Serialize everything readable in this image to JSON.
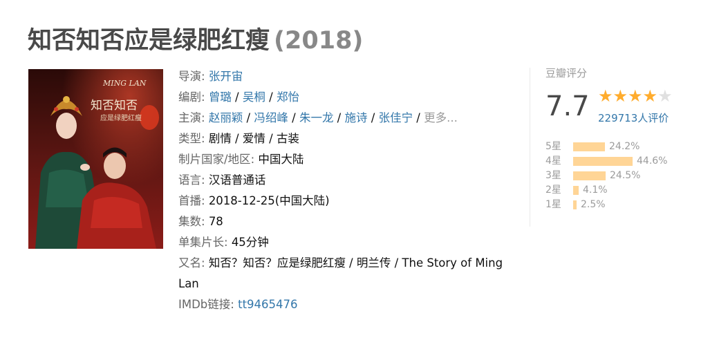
{
  "title": "知否知否应是绿肥红瘦",
  "year": "(2018)",
  "poster": {
    "alt": "知否知否应是绿肥红瘦 海报",
    "logo_en": "MING LAN",
    "logo_cn": "知否知否",
    "logo_sub": "应是绿肥红瘦"
  },
  "info": {
    "director_label": "导演",
    "directors": [
      "张开宙"
    ],
    "writer_label": "编剧",
    "writers": [
      "曾璐",
      "吴桐",
      "郑怡"
    ],
    "cast_label": "主演",
    "cast": [
      "赵丽颖",
      "冯绍峰",
      "朱一龙",
      "施诗",
      "张佳宁"
    ],
    "more_label": "更多...",
    "genre_label": "类型",
    "genre_value": "剧情 / 爱情 / 古装",
    "country_label": "制片国家/地区",
    "country_value": "中国大陆",
    "language_label": "语言",
    "language_value": "汉语普通话",
    "premiere_label": "首播",
    "premiere_value": "2018-12-25(中国大陆)",
    "episodes_label": "集数",
    "episodes_value": "78",
    "runtime_label": "单集片长",
    "runtime_value": "45分钟",
    "aka_label": "又名",
    "aka_value": "知否？知否？应是绿肥红瘦 / 明兰传 / The Story of Ming Lan",
    "imdb_label": "IMDb链接",
    "imdb_value": "tt9465476",
    "colon": ": "
  },
  "rating": {
    "label": "豆瓣评分",
    "score": "7.7",
    "stars_filled": 4,
    "stars_total": 5,
    "count_text": "229713人评价",
    "distribution": [
      {
        "label": "5星",
        "pct": "24.2%",
        "value": 24.2
      },
      {
        "label": "4星",
        "pct": "44.6%",
        "value": 44.6
      },
      {
        "label": "3星",
        "pct": "24.5%",
        "value": 24.5
      },
      {
        "label": "2星",
        "pct": "4.1%",
        "value": 4.1
      },
      {
        "label": "1星",
        "pct": "2.5%",
        "value": 2.5
      }
    ]
  },
  "colors": {
    "link": "#3377aa",
    "star": "#ffac2d",
    "bar": "#ffd596",
    "title": "#494949"
  }
}
